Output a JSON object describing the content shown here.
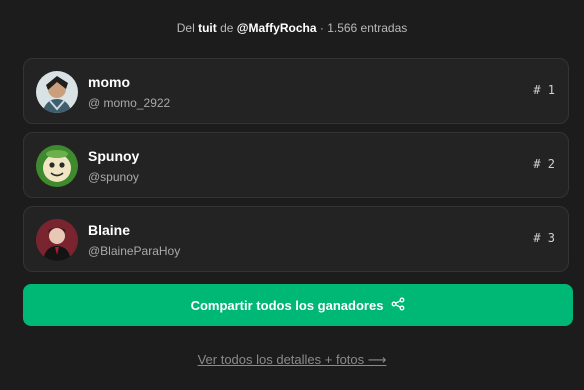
{
  "header": {
    "prefix": "Del",
    "tweet_word": "tuit",
    "middle": "de",
    "user": "@MaffyRocha",
    "suffix": "· 1.566 entradas"
  },
  "winners": [
    {
      "name": "momo",
      "handle": "@ momo_2922",
      "rank": "# 1",
      "avatar_icon": "avatar-anime-character-icon"
    },
    {
      "name": "Spunoy",
      "handle": "@spunoy",
      "rank": "# 2",
      "avatar_icon": "avatar-cartoon-face-icon"
    },
    {
      "name": "Blaine",
      "handle": "@BlaineParaHoy",
      "rank": "# 3",
      "avatar_icon": "avatar-portrait-icon"
    }
  ],
  "share_button": {
    "label": "Compartir todos los ganadores",
    "icon": "share-icon"
  },
  "details_link": {
    "label": "Ver todos los detalles + fotos ⟶"
  },
  "colors": {
    "background": "#1c1c1c",
    "card": "#232323",
    "accent": "#00b876"
  }
}
